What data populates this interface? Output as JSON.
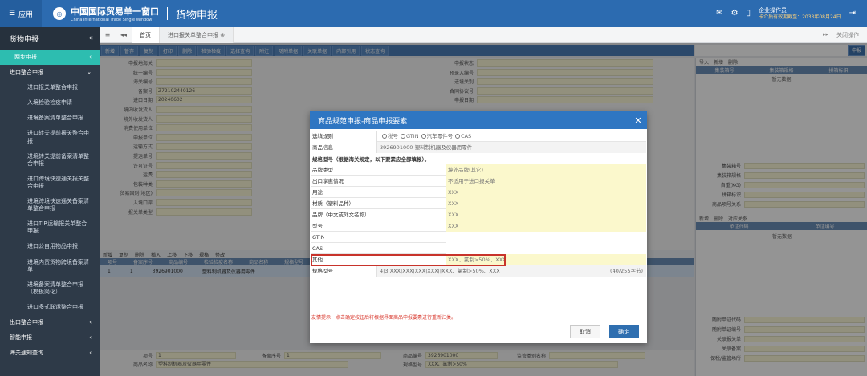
{
  "topbar": {
    "menu_label": "应用",
    "logo_cn": "中国国际贸易单一窗口",
    "logo_en": "China International Trade Single Window",
    "app_title": "货物申报",
    "user_role": "企业操作员",
    "expiry": "卡介质有效期截至：2033年08月24日"
  },
  "sidebar": {
    "title": "货物申报",
    "items": [
      {
        "label": "两步申报",
        "kind": "active"
      },
      {
        "label": "进口整合申报",
        "kind": "group"
      },
      {
        "label": "进口报关单整合申报",
        "kind": "sub"
      },
      {
        "label": "入境检验检疫申请",
        "kind": "sub"
      },
      {
        "label": "进境备案清单整合申报",
        "kind": "sub"
      },
      {
        "label": "进口转关提前报关整合申报",
        "kind": "sub"
      },
      {
        "label": "进境转关提前备案清单整合申报",
        "kind": "sub"
      },
      {
        "label": "进口跨境快速通关报关整合申报",
        "kind": "sub"
      },
      {
        "label": "进境跨境快速通关备案清单整合申报",
        "kind": "sub"
      },
      {
        "label": "进口TIR运输报关单整合申报",
        "kind": "sub"
      },
      {
        "label": "进口公自用物品申报",
        "kind": "sub"
      },
      {
        "label": "进境内贸货物跨境备案清单",
        "kind": "sub"
      },
      {
        "label": "进境备案清单整合申报（模板简化）",
        "kind": "sub"
      },
      {
        "label": "进口多式联运整合申报",
        "kind": "sub"
      },
      {
        "label": "出口整合申报",
        "kind": "group"
      },
      {
        "label": "智能申报",
        "kind": "group"
      },
      {
        "label": "海关通知查询",
        "kind": "group"
      }
    ]
  },
  "tabbar": {
    "home": "首页",
    "doc_tab": "进口报关单整合申报",
    "close_all": "关闭操作"
  },
  "toolbar": {
    "buttons": [
      "新增",
      "暂存",
      "复制",
      "打印",
      "删除",
      "检验检疫",
      "选择查询",
      "附注",
      "随附单据",
      "关联单据",
      "内部引用",
      "状态查询"
    ],
    "right_button": "申报"
  },
  "form_fields": [
    {
      "label": "申报地海关",
      "value": ""
    },
    {
      "label": "统一编号",
      "value": ""
    },
    {
      "label": "海关编号",
      "value": ""
    },
    {
      "label": "备案号",
      "value": "Z72102440126"
    },
    {
      "label": "进口日期",
      "value": "20240602"
    },
    {
      "label": "境内收发货人",
      "value": ""
    },
    {
      "label": "境外收发货人",
      "value": ""
    },
    {
      "label": "消费使用单位",
      "value": ""
    },
    {
      "label": "申报单位",
      "value": ""
    },
    {
      "label": "运输方式",
      "value": ""
    },
    {
      "label": "提运单号",
      "value": ""
    },
    {
      "label": "许可证号",
      "value": ""
    },
    {
      "label": "运费",
      "value": ""
    },
    {
      "label": "包装种类",
      "value": ""
    },
    {
      "label": "贸易国别(地区)",
      "value": ""
    },
    {
      "label": "入境口岸",
      "value": ""
    },
    {
      "label": "报关单类型",
      "value": ""
    }
  ],
  "form_fields_right": [
    {
      "label": "申报状态",
      "value": ""
    },
    {
      "label": "预录入编号",
      "value": ""
    },
    {
      "label": "进境关别",
      "value": ""
    },
    {
      "label": "合同协议号",
      "value": ""
    },
    {
      "label": "申报日期",
      "value": ""
    }
  ],
  "right_panel": {
    "bar": [
      "导入",
      "新增",
      "删除"
    ],
    "headers": [
      "集装箱号",
      "集装箱规格",
      "拼箱标识"
    ],
    "empty": "暂无数据",
    "fields": [
      "集装箱号",
      "集装箱规格",
      "自重(KG)",
      "拼箱标识",
      "商品项号关系"
    ],
    "bar2": [
      "新增",
      "删除",
      "对应关系"
    ],
    "headers2": [
      "单证代码",
      "单证编号"
    ],
    "empty2": "暂无数据",
    "fields2": [
      "随附单证代码",
      "随附单证编号",
      "关联报关单",
      "关联备案",
      "保税/监管场所"
    ]
  },
  "grid": {
    "bar": [
      "新增",
      "复制",
      "删除",
      "插入",
      "上移",
      "下移",
      "规格",
      "整改"
    ],
    "headers": [
      "项号",
      "备案序号",
      "商品编号",
      "检验检疫名称",
      "商品名称",
      "规格型号"
    ],
    "row": [
      "1",
      "1",
      "3926901000",
      "塑料制机器及仪器用零件"
    ]
  },
  "bottom": {
    "item_no_label": "项号",
    "item_no": "1",
    "record_no_label": "备案序号",
    "record_no": "1",
    "hs_label": "商品编号",
    "hs": "3926901000",
    "name_label": "商品名称",
    "name": "塑料制机器及仪器用零件",
    "spec_label": "规格型号",
    "spec": "XXX、氯制>50%",
    "supervision_label": "监管类别名称"
  },
  "modal": {
    "title": "商品规范申报-商品申报要素",
    "rule_label": "选填规则",
    "rule_options": [
      "税号",
      "GTIN",
      "汽车零件号",
      "CAS"
    ],
    "goods_label": "商品信息",
    "goods_value": "3926901000-塑料制机器及仪器用零件",
    "note": "规格型号（根据海关规定，以下要素应全部填报）。",
    "elements": [
      {
        "label": "品牌类型",
        "value": "境外品牌(其它)"
      },
      {
        "label": "出口享惠情况",
        "value": "不适用于进口报关单"
      },
      {
        "label": "用途",
        "value": "XXX"
      },
      {
        "label": "材质（塑料品种）",
        "value": "XXX"
      },
      {
        "label": "品牌（中文或外文名称）",
        "value": "XXX"
      },
      {
        "label": "型号",
        "value": "XXX"
      },
      {
        "label": "GTIN",
        "value": ""
      },
      {
        "label": "CAS",
        "value": ""
      },
      {
        "label": "其他",
        "value": "XXX、氯制>50%、XXX"
      }
    ],
    "spec_label": "规格型号",
    "spec_value": "4|3|XXX|XXX|XXX|XXX||XXX、氯制>50%、XXX",
    "spec_count": "(40/255字节)",
    "hint": "友情提示：点击确定按钮后将根据界面商品申报要素进行重新归类。",
    "cancel": "取消",
    "confirm": "确定"
  }
}
